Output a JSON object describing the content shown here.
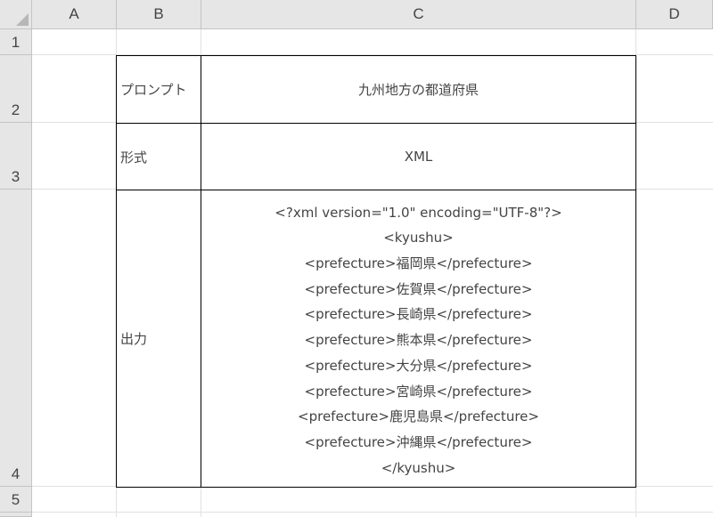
{
  "columns": [
    "A",
    "B",
    "C",
    "D"
  ],
  "rows": [
    "1",
    "2",
    "3",
    "4",
    "5"
  ],
  "table": {
    "prompt_label": "プロンプト",
    "prompt_value": "九州地方の都道府県",
    "format_label": "形式",
    "format_value": "XML",
    "output_label": "出力",
    "output_lines": [
      "<?xml version=\"1.0\" encoding=\"UTF-8\"?>",
      "<kyushu>",
      "<prefecture>福岡県</prefecture>",
      "<prefecture>佐賀県</prefecture>",
      "<prefecture>長崎県</prefecture>",
      "<prefecture>熊本県</prefecture>",
      "<prefecture>大分県</prefecture>",
      "<prefecture>宮崎県</prefecture>",
      "<prefecture>鹿児島県</prefecture>",
      "<prefecture>沖縄県</prefecture>",
      "</kyushu>"
    ]
  }
}
